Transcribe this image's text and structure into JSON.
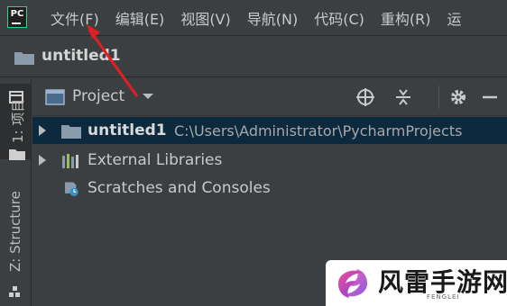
{
  "menubar": {
    "logo_text": "PC",
    "items": [
      "文件(F)",
      "编辑(E)",
      "视图(V)",
      "导航(N)",
      "代码(C)",
      "重构(R)",
      "运"
    ]
  },
  "navbar": {
    "project_name": "untitled1"
  },
  "toolstrip": {
    "project_tab": "1: 项目",
    "structure_tab": "Z: Structure"
  },
  "panel": {
    "title": "Project",
    "buttons": [
      "locate-icon",
      "collapse-all-icon",
      "gear-icon",
      "minimize-icon"
    ]
  },
  "tree": {
    "items": [
      {
        "label": "untitled1",
        "path": "C:\\Users\\Administrator\\PycharmProjects",
        "icon": "folder-icon"
      },
      {
        "label": "External Libraries",
        "icon": "library-icon"
      },
      {
        "label": "Scratches and Consoles",
        "icon": "scratches-icon"
      }
    ]
  },
  "watermark": {
    "name": "风雷手游网",
    "sub": "FENGLEI"
  },
  "colors": {
    "background": "#3c3f41",
    "selection": "#0d293e",
    "folder": "#8a9bab",
    "annotation": "#e02020",
    "logo_accent": "#21d789"
  }
}
